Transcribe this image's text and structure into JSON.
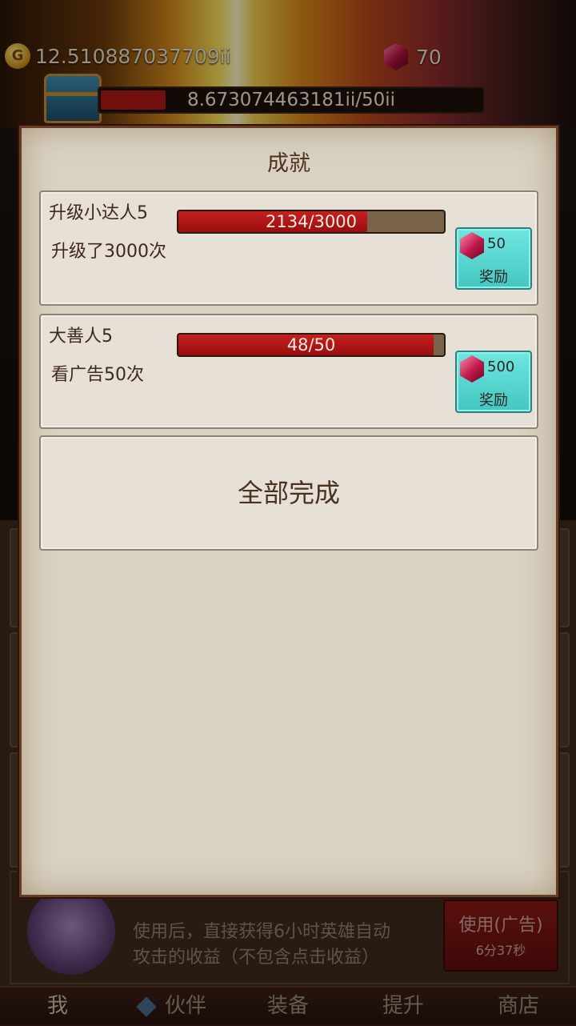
{
  "hud": {
    "gold": "12.510887037709ii",
    "gems": "70",
    "hp_text": "8.673074463181ii/50ii",
    "hp_fraction": 0.17
  },
  "background_panel": {
    "info_line1": "使用后，直接获得6小时英雄自动",
    "info_line2": "攻击的收益（不包含点击收益）",
    "use_button_label": "使用(广告)",
    "use_button_timer": "6分37秒"
  },
  "navbar": {
    "items": [
      "我",
      "伙伴",
      "装备",
      "提升",
      "商店"
    ]
  },
  "dialog": {
    "title": "成就",
    "achievements": [
      {
        "name": "升级小达人5",
        "description": "升级了3000次",
        "progress_text": "2134/3000",
        "progress_fraction": 0.711,
        "reward_amount": "50",
        "reward_label": "奖励"
      },
      {
        "name": "大善人5",
        "description": "看广告50次",
        "progress_text": "48/50",
        "progress_fraction": 0.96,
        "reward_amount": "500",
        "reward_label": "奖励"
      }
    ],
    "complete_all_label": "全部完成"
  },
  "colors": {
    "dialog_bg": "#d9d2c2",
    "progress_fill": "#c42020",
    "reward_button": "#5fd9d3"
  }
}
